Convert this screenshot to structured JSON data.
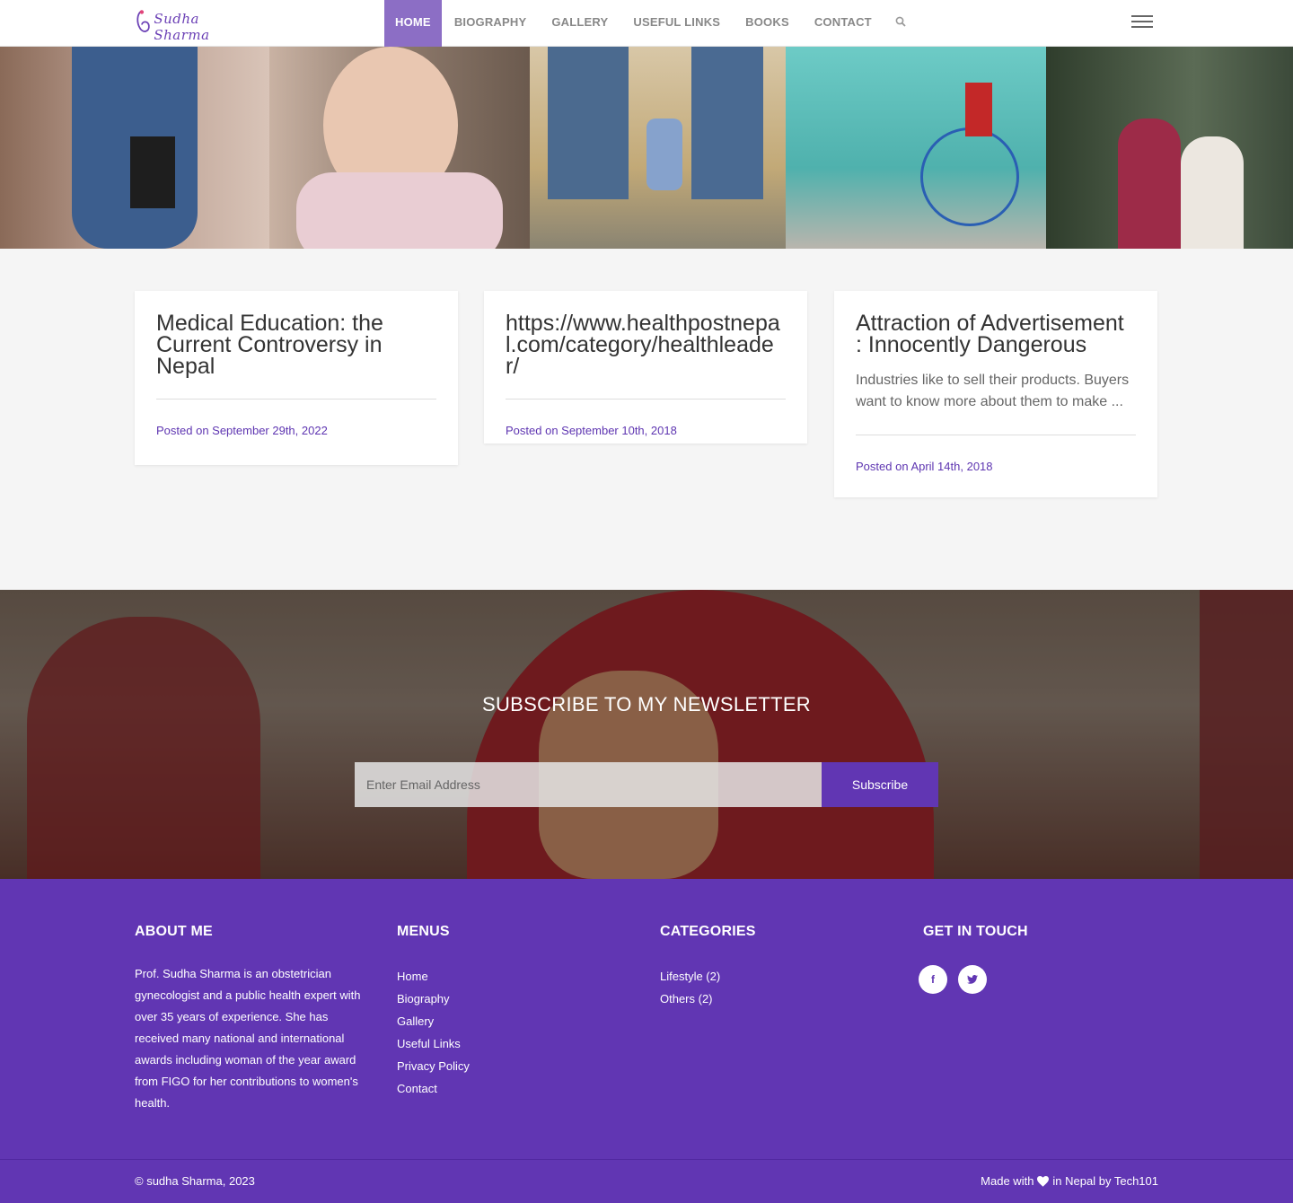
{
  "brand": {
    "name": "Sudha Sharma",
    "accent": "#6136b3",
    "nav_active": "#8c6ec5"
  },
  "nav": {
    "items": [
      "HOME",
      "BIOGRAPHY",
      "GALLERY",
      "USEFUL LINKS",
      "BOOKS",
      "CONTACT"
    ],
    "active": "HOME",
    "search_icon": "search-icon",
    "menu_icon": "hamburger-icon"
  },
  "posts": [
    {
      "title": "Medical Education: the Current Controversy in Nepal",
      "excerpt": "",
      "posted": "Posted on September 29th, 2022"
    },
    {
      "title": "https://www.healthpostnepal.com/category/healthleader/",
      "excerpt": "",
      "posted": "Posted on September 10th, 2018"
    },
    {
      "title": "Attraction of Advertisement : Innocently Dangerous",
      "excerpt": "Industries like to sell their products. Buyers want to know more about them to make ...",
      "posted": "Posted on April 14th, 2018"
    }
  ],
  "newsletter": {
    "heading": "SUBSCRIBE TO MY NEWSLETTER",
    "placeholder": "Enter Email Address",
    "button": "Subscribe"
  },
  "footer": {
    "about": {
      "heading": "ABOUT ME",
      "text": "Prof. Sudha Sharma is an obstetrician gynecologist and a public health expert with over 35 years of experience. She has received many national and international awards including woman of the year award from FIGO for her contributions to women's health."
    },
    "menus": {
      "heading": "MENUS",
      "items": [
        "Home",
        "Biography",
        "Gallery",
        "Useful Links",
        "Privacy Policy",
        "Contact"
      ]
    },
    "categories": {
      "heading": "CATEGORIES",
      "items": [
        "Lifestyle (2)",
        "Others (2)"
      ]
    },
    "contact": {
      "heading": "GET IN TOUCH",
      "social": [
        "f",
        "t"
      ]
    },
    "copyright": "© sudha Sharma, 2023",
    "made_prefix": "Made with",
    "made_suffix": "in Nepal by Tech101"
  }
}
